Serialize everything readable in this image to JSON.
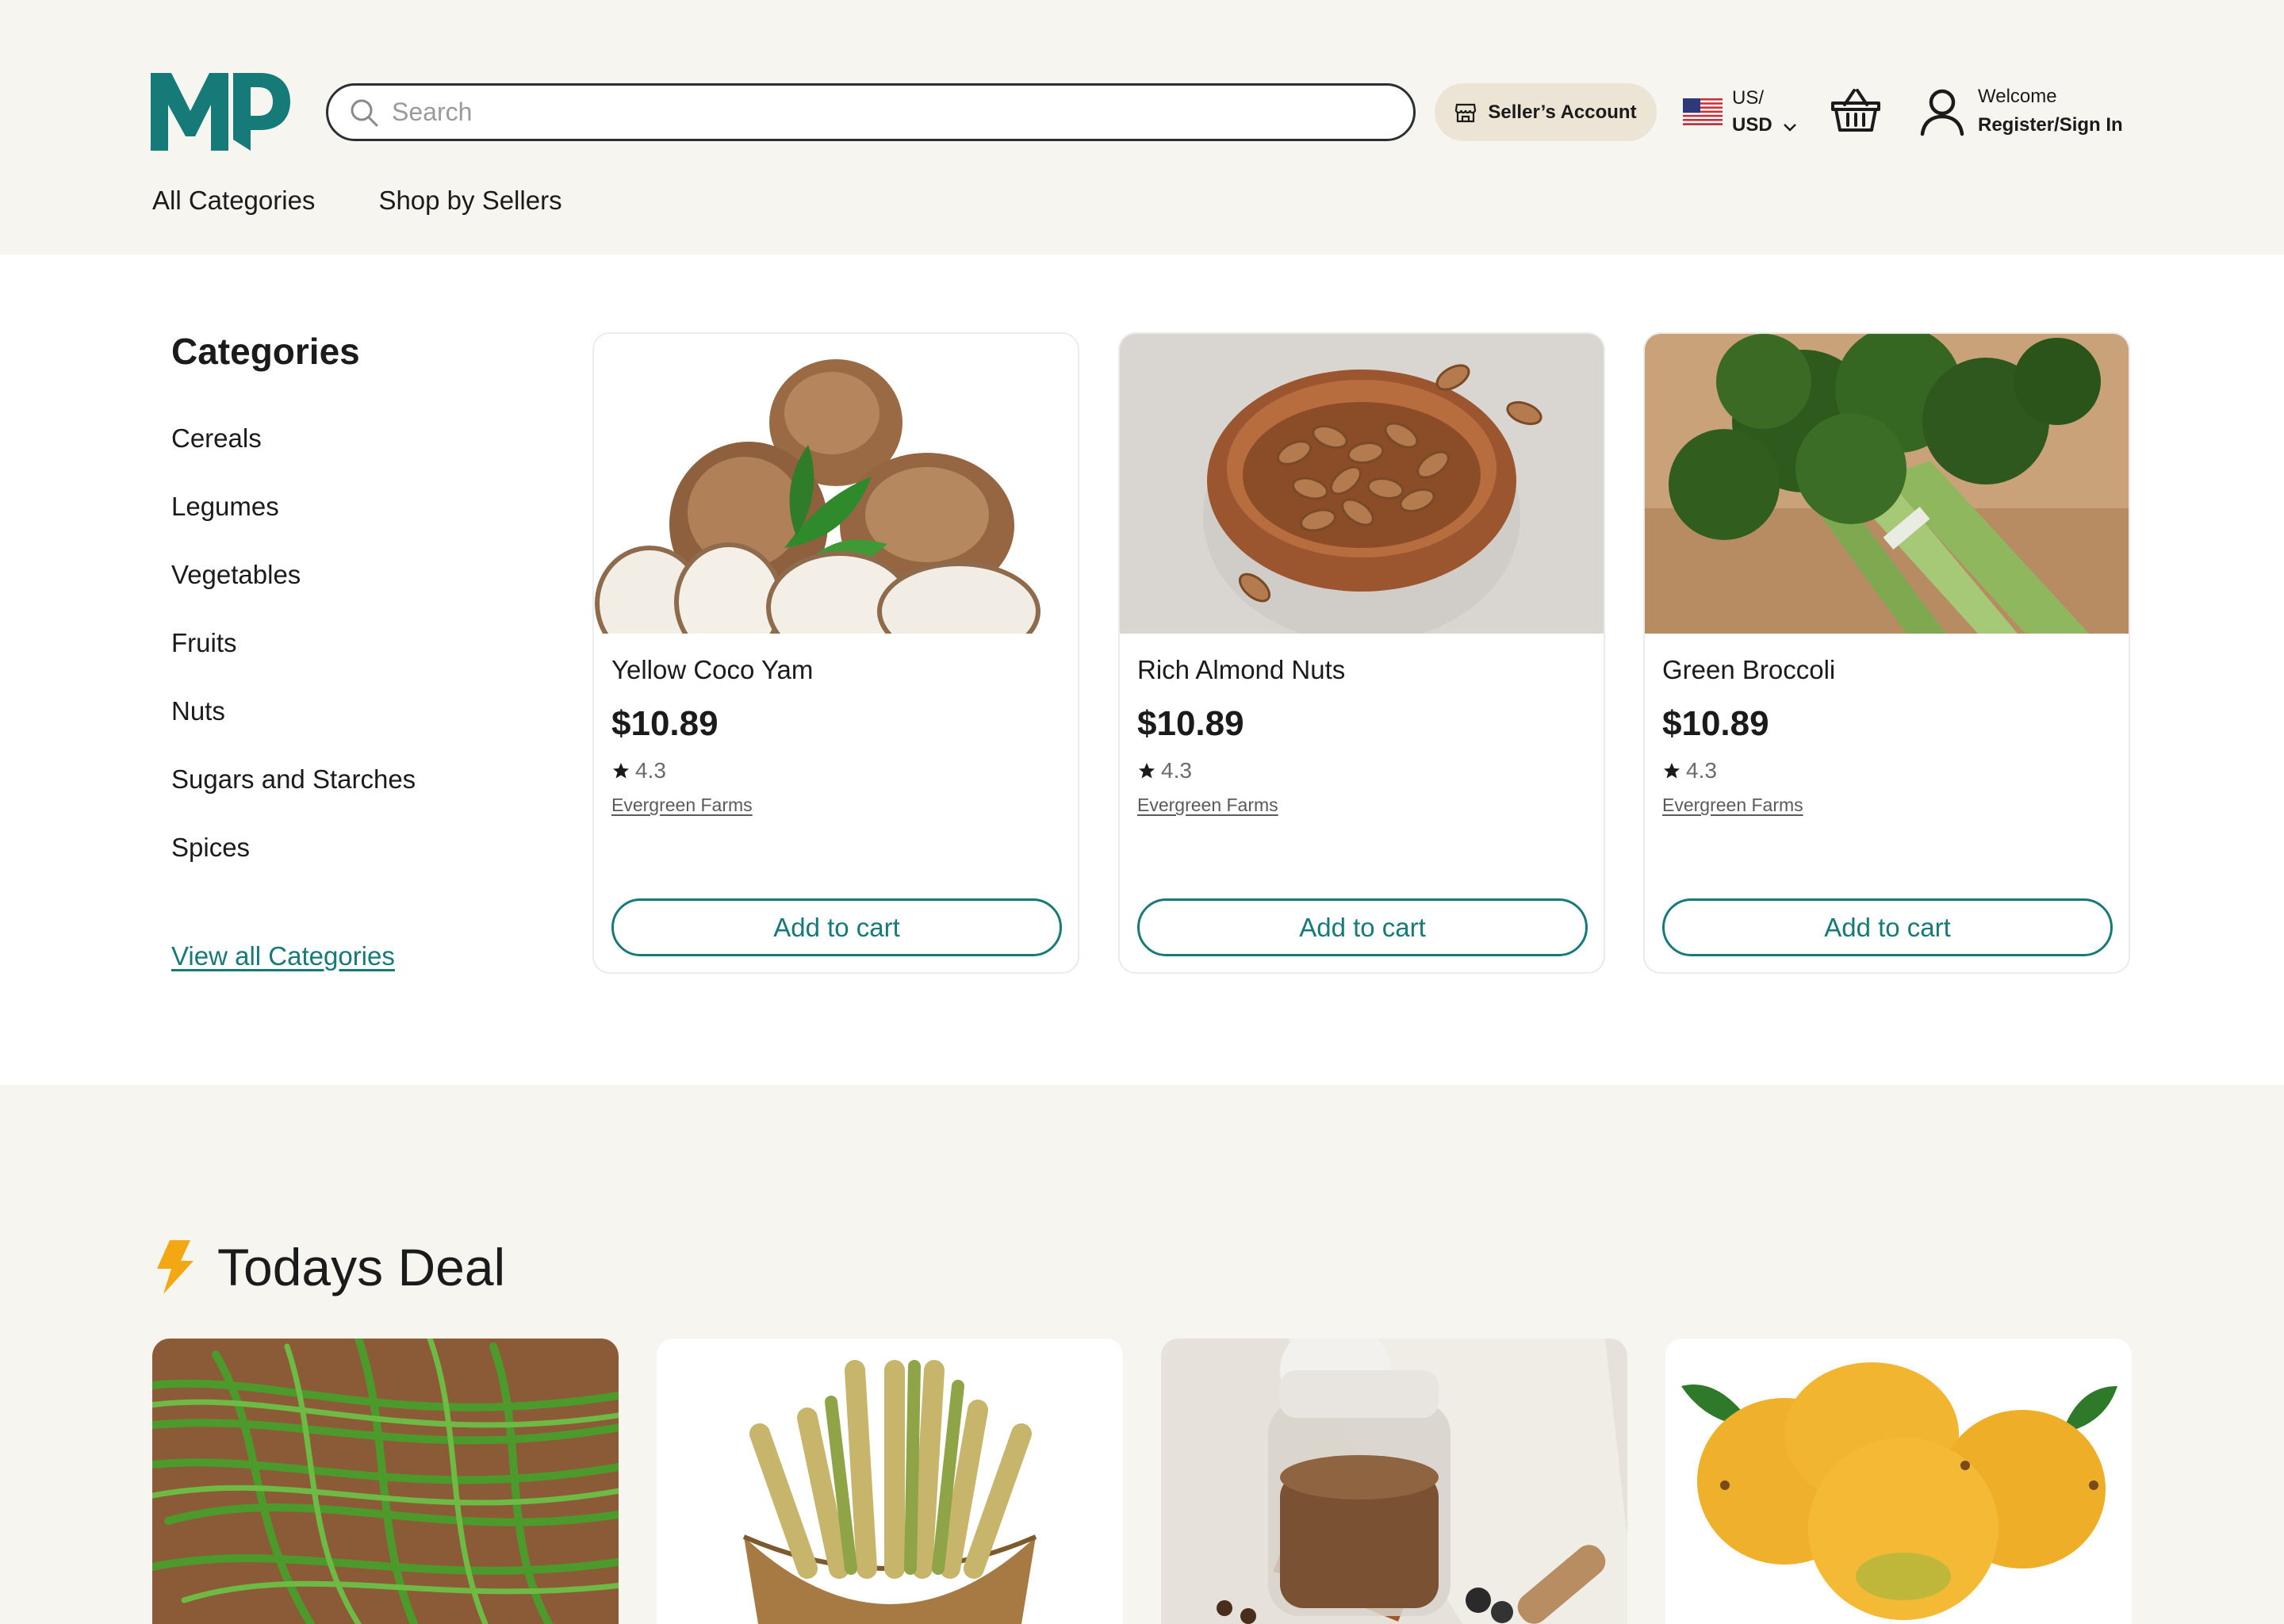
{
  "header": {
    "logo_text": "MP",
    "search_placeholder": "Search",
    "seller_account_label": "Seller’s Account",
    "locale_line1": "US/",
    "locale_line2": "USD",
    "welcome": "Welcome",
    "register": "Register/Sign In"
  },
  "nav": [
    "All Categories",
    "Shop by Sellers"
  ],
  "categories": {
    "title": "Categories",
    "items": [
      "Cereals",
      "Legumes",
      "Vegetables",
      "Fruits",
      "Nuts",
      "Sugars and Starches",
      "Spices"
    ],
    "view_all": "View all Categories"
  },
  "products": [
    {
      "name": "Yellow Coco Yam",
      "price": "$10.89",
      "rating": "4.3",
      "seller": "Evergreen Farms",
      "cta": "Add to cart",
      "image": "coco-yam"
    },
    {
      "name": "Rich Almond Nuts",
      "price": "$10.89",
      "rating": "4.3",
      "seller": "Evergreen Farms",
      "cta": "Add to cart",
      "image": "almonds"
    },
    {
      "name": "Green Broccoli",
      "price": "$10.89",
      "rating": "4.3",
      "seller": "Evergreen Farms",
      "cta": "Add to cart",
      "image": "broccoli"
    }
  ],
  "deals": {
    "title": "Todays Deal",
    "items": [
      "green-beans",
      "sugarcane",
      "spice-jar",
      "mangoes"
    ]
  },
  "colors": {
    "brand": "#157a78",
    "background": "#f6f5f0",
    "seller_button": "#ece4d4",
    "deal_icon": "#f3a712"
  }
}
